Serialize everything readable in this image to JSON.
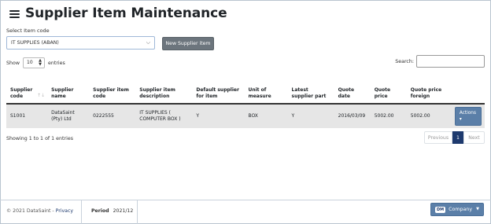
{
  "page": {
    "title": "Supplier Item Maintenance"
  },
  "filter": {
    "select_label": "Select Item code",
    "selected_item": "IT SUPPLIES (ABAN)",
    "new_button": "New Supplier item"
  },
  "table_controls": {
    "show_label": "Show",
    "entries_value": "10",
    "entries_label": "entries",
    "search_label": "Search:",
    "search_value": ""
  },
  "table": {
    "columns": [
      "Supplier code",
      "Supplier name",
      "Supplier item code",
      "Supplier item description",
      "Default supplier for item",
      "Unit of measure",
      "Latest supplier part",
      "Quote date",
      "Quote price",
      "Quote price foreign",
      ""
    ],
    "rows": [
      {
        "supplier_code": "S1001",
        "supplier_name": "DataSaint (Pty) Ltd",
        "supplier_item_code": "0222555",
        "description": "IT SUPPLIES ( COMPUTER BOX )",
        "default_supplier": "Y",
        "unit": "BOX",
        "latest_part": "Y",
        "quote_date": "2016/03/09",
        "quote_price": "5002.00",
        "quote_price_foreign": "5002.00",
        "actions_label": "Actions"
      }
    ]
  },
  "pagination": {
    "info": "Showing 1 to 1 of 1 entries",
    "previous": "Previous",
    "current": "1",
    "next": "Next"
  },
  "footer": {
    "copyright": "© 2021 DataSaint - ",
    "privacy": "Privacy",
    "period_label": "Period",
    "period_value": "2021/12",
    "company_badge": "DM",
    "company_label": "Company"
  },
  "colors": {
    "primary": "#1e3a6e",
    "action_button": "#5b7fa8",
    "secondary_button": "#6c757d",
    "row_background": "#e6e6e6"
  }
}
